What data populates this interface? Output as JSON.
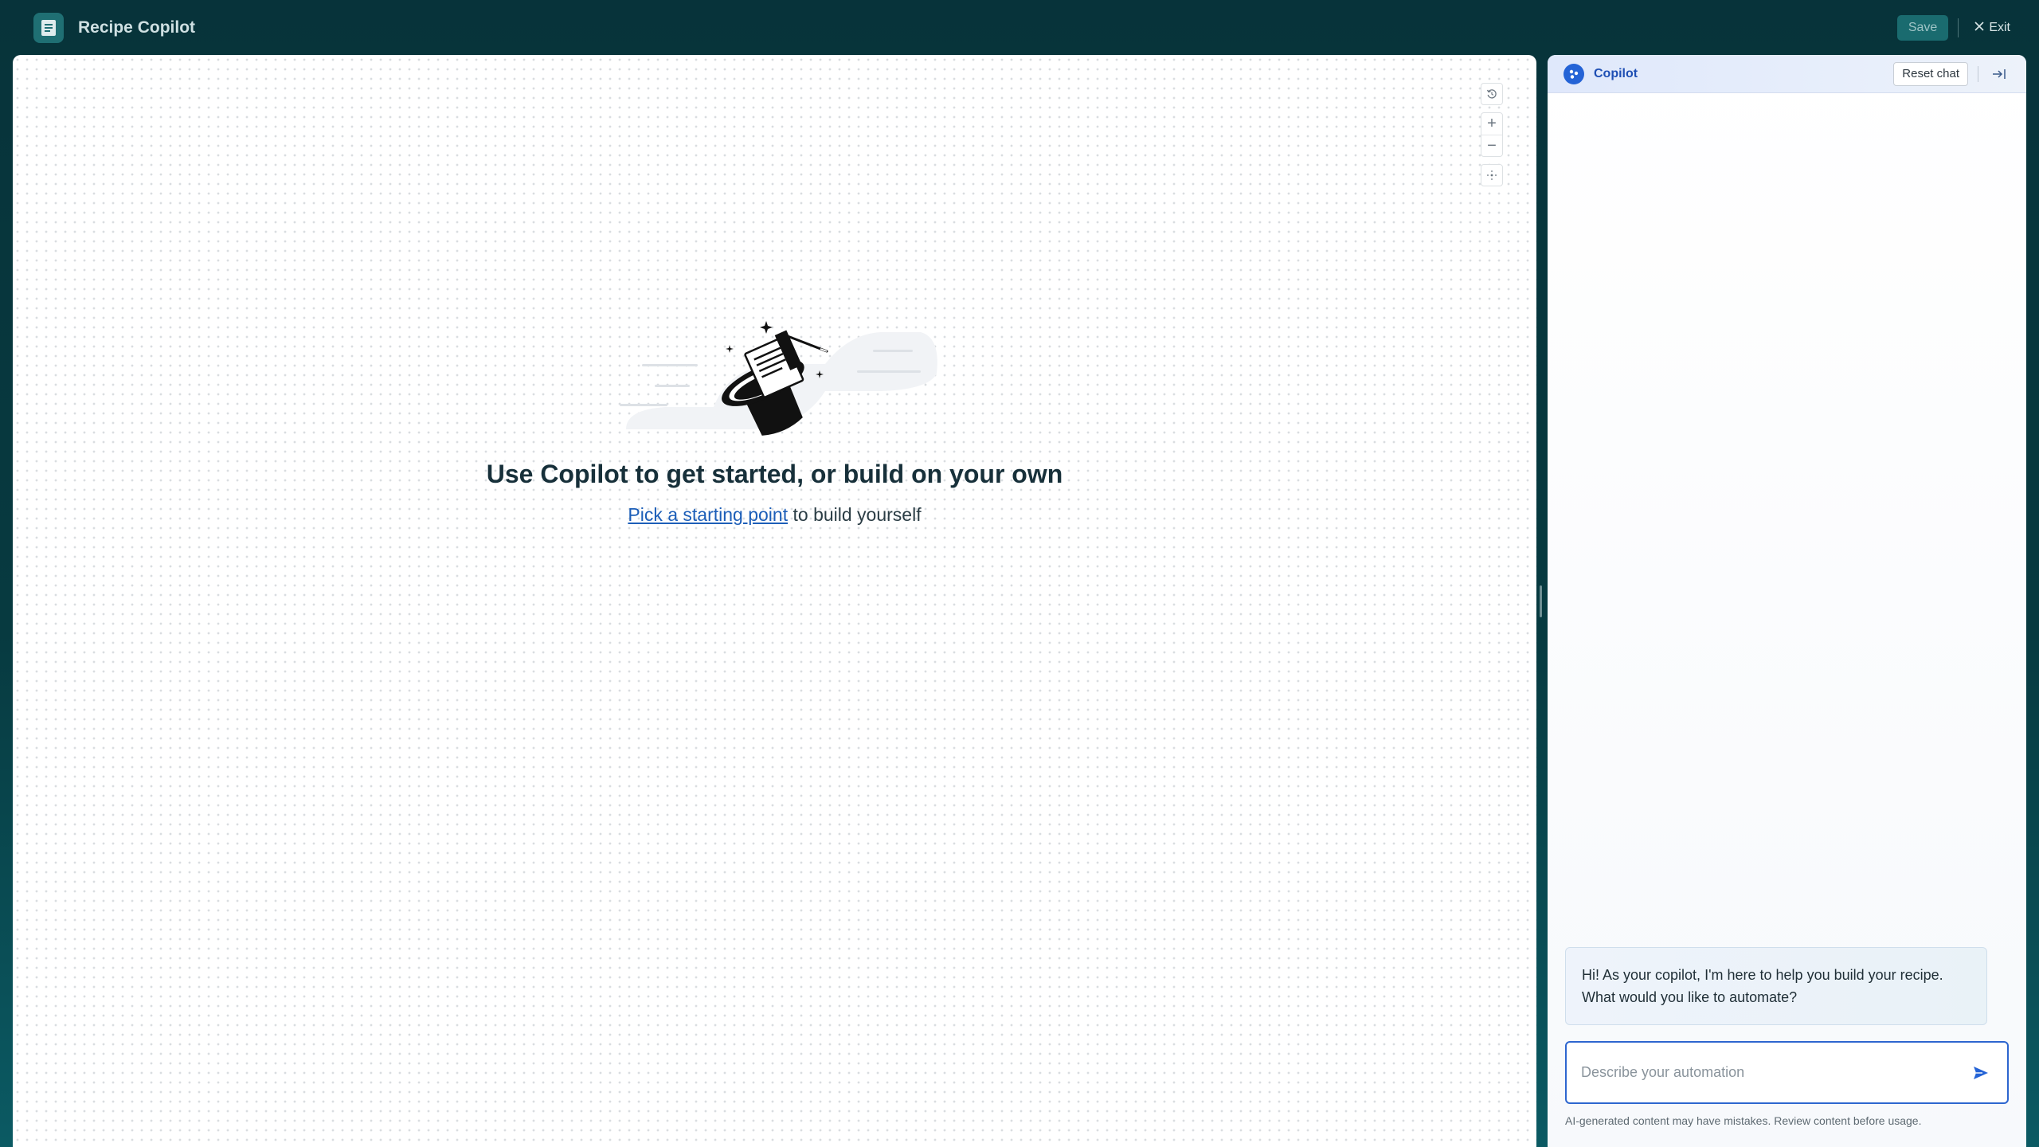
{
  "app": {
    "title": "Recipe Copilot",
    "logo_icon": "document-icon"
  },
  "toolbar": {
    "save_label": "Save",
    "exit_label": "Exit",
    "exit_icon": "close-icon"
  },
  "canvas": {
    "tools": {
      "reset_icon": "history-icon",
      "zoom_in": "+",
      "zoom_out": "−",
      "fit_icon": "fit-to-screen-icon"
    },
    "empty_state": {
      "illustration": "magic-hat-illustration",
      "title": "Use Copilot to get started, or build on your own",
      "link_text": "Pick a starting point",
      "subtitle_rest": " to build yourself"
    }
  },
  "copilot": {
    "title": "Copilot",
    "reset_label": "Reset chat",
    "collapse_icon": "collapse-panel-icon",
    "messages": [
      {
        "role": "assistant",
        "text": "Hi! As your copilot, I'm here to help you build your recipe. What would you like to automate?"
      }
    ],
    "input_placeholder": "Describe your automation",
    "send_icon": "send-icon",
    "disclaimer": "AI-generated content may have mistakes. Review content before usage."
  },
  "colors": {
    "topbar_bg": "#07343a",
    "accent_blue": "#2463d6",
    "link_blue": "#1c5eb8",
    "title_text": "#17303a"
  }
}
